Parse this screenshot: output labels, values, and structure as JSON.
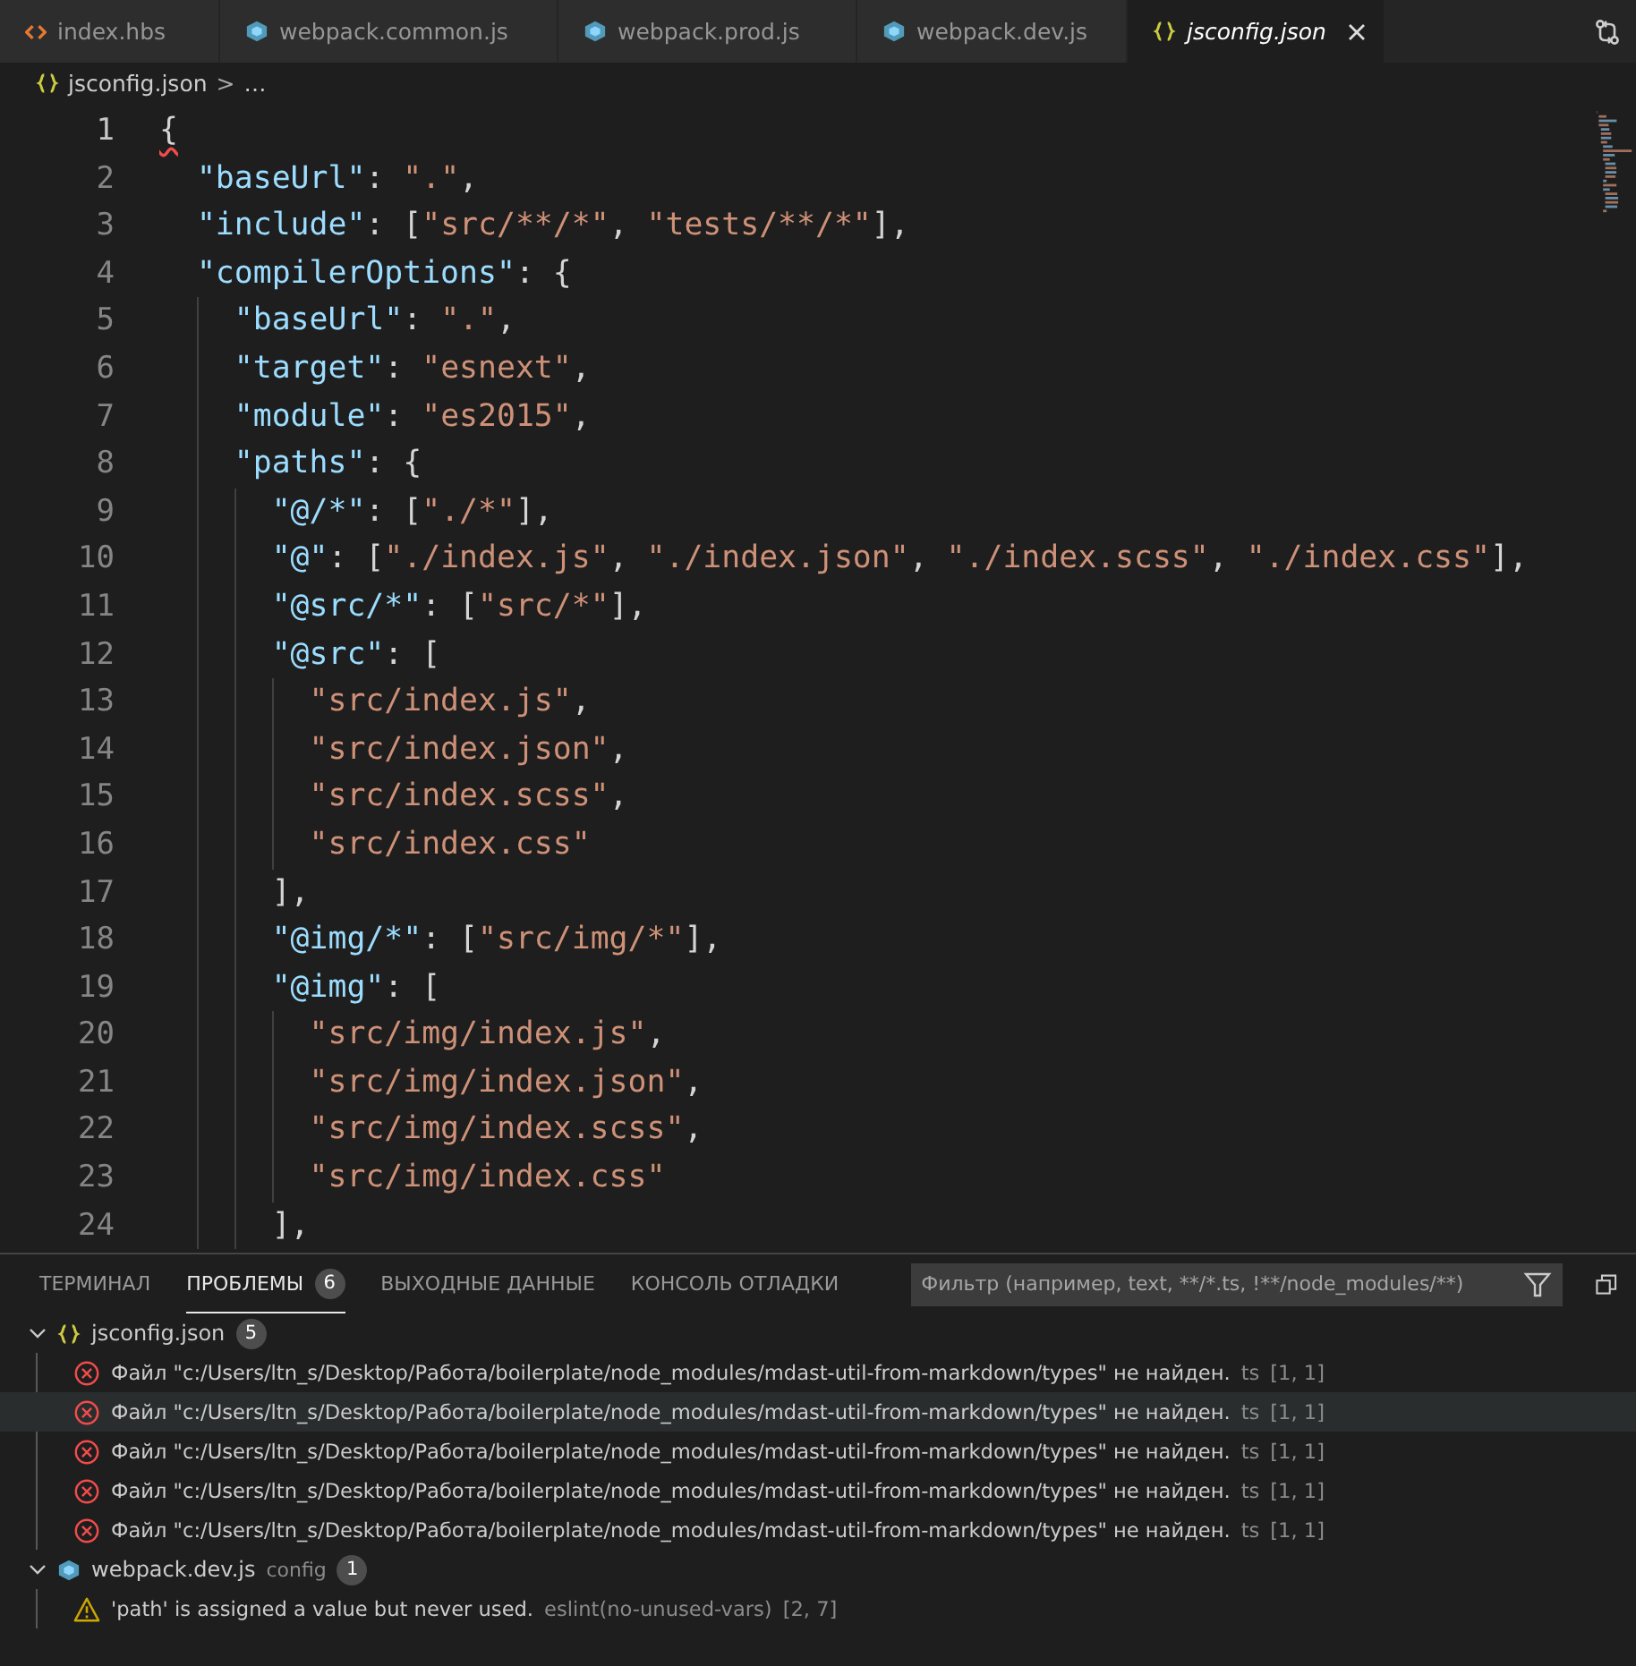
{
  "tabs": [
    {
      "label": "index.hbs",
      "kind": "html",
      "selected": false,
      "italic": false
    },
    {
      "label": "webpack.common.js",
      "kind": "webpack",
      "selected": false,
      "italic": false
    },
    {
      "label": "webpack.prod.js",
      "kind": "webpack",
      "selected": false,
      "italic": false
    },
    {
      "label": "webpack.dev.js",
      "kind": "webpack",
      "selected": false,
      "italic": false
    },
    {
      "label": "jsconfig.json",
      "kind": "json",
      "selected": true,
      "italic": true
    }
  ],
  "breadcrumb": {
    "kind": "json",
    "file": "jsconfig.json",
    "separator": ">",
    "rest": "…"
  },
  "editor": {
    "lines": [
      {
        "number": "1",
        "current": true,
        "squiggle": true,
        "tokens": [
          {
            "kind": "punct",
            "text": "{"
          }
        ]
      },
      {
        "number": "2",
        "current": false,
        "squiggle": false,
        "tokens": [
          {
            "kind": "key",
            "text": "  \"baseUrl\""
          },
          {
            "kind": "punct",
            "text": ": "
          },
          {
            "kind": "string",
            "text": "\".\""
          },
          {
            "kind": "punct",
            "text": ","
          }
        ]
      },
      {
        "number": "3",
        "current": false,
        "squiggle": false,
        "tokens": [
          {
            "kind": "key",
            "text": "  \"include\""
          },
          {
            "kind": "punct",
            "text": ": ["
          },
          {
            "kind": "string",
            "text": "\"src/**/*\""
          },
          {
            "kind": "punct",
            "text": ", "
          },
          {
            "kind": "string",
            "text": "\"tests/**/*\""
          },
          {
            "kind": "punct",
            "text": "],"
          }
        ]
      },
      {
        "number": "4",
        "current": false,
        "squiggle": false,
        "tokens": [
          {
            "kind": "key",
            "text": "  \"compilerOptions\""
          },
          {
            "kind": "punct",
            "text": ": {"
          }
        ]
      },
      {
        "number": "5",
        "current": false,
        "squiggle": false,
        "tokens": [
          {
            "kind": "key",
            "text": "    \"baseUrl\""
          },
          {
            "kind": "punct",
            "text": ": "
          },
          {
            "kind": "string",
            "text": "\".\""
          },
          {
            "kind": "punct",
            "text": ","
          }
        ]
      },
      {
        "number": "6",
        "current": false,
        "squiggle": false,
        "tokens": [
          {
            "kind": "key",
            "text": "    \"target\""
          },
          {
            "kind": "punct",
            "text": ": "
          },
          {
            "kind": "string",
            "text": "\"esnext\""
          },
          {
            "kind": "punct",
            "text": ","
          }
        ]
      },
      {
        "number": "7",
        "current": false,
        "squiggle": false,
        "tokens": [
          {
            "kind": "key",
            "text": "    \"module\""
          },
          {
            "kind": "punct",
            "text": ": "
          },
          {
            "kind": "string",
            "text": "\"es2015\""
          },
          {
            "kind": "punct",
            "text": ","
          }
        ]
      },
      {
        "number": "8",
        "current": false,
        "squiggle": false,
        "tokens": [
          {
            "kind": "key",
            "text": "    \"paths\""
          },
          {
            "kind": "punct",
            "text": ": {"
          }
        ]
      },
      {
        "number": "9",
        "current": false,
        "squiggle": false,
        "tokens": [
          {
            "kind": "key",
            "text": "      \"@/*\""
          },
          {
            "kind": "punct",
            "text": ": ["
          },
          {
            "kind": "string",
            "text": "\"./*\""
          },
          {
            "kind": "punct",
            "text": "],"
          }
        ]
      },
      {
        "number": "10",
        "current": false,
        "squiggle": false,
        "tokens": [
          {
            "kind": "key",
            "text": "      \"@\""
          },
          {
            "kind": "punct",
            "text": ": ["
          },
          {
            "kind": "string",
            "text": "\"./index.js\""
          },
          {
            "kind": "punct",
            "text": ", "
          },
          {
            "kind": "string",
            "text": "\"./index.json\""
          },
          {
            "kind": "punct",
            "text": ", "
          },
          {
            "kind": "string",
            "text": "\"./index.scss\""
          },
          {
            "kind": "punct",
            "text": ", "
          },
          {
            "kind": "string",
            "text": "\"./index.css\""
          },
          {
            "kind": "punct",
            "text": "],"
          }
        ]
      },
      {
        "number": "11",
        "current": false,
        "squiggle": false,
        "tokens": [
          {
            "kind": "key",
            "text": "      \"@src/*\""
          },
          {
            "kind": "punct",
            "text": ": ["
          },
          {
            "kind": "string",
            "text": "\"src/*\""
          },
          {
            "kind": "punct",
            "text": "],"
          }
        ]
      },
      {
        "number": "12",
        "current": false,
        "squiggle": false,
        "tokens": [
          {
            "kind": "key",
            "text": "      \"@src\""
          },
          {
            "kind": "punct",
            "text": ": ["
          }
        ]
      },
      {
        "number": "13",
        "current": false,
        "squiggle": false,
        "tokens": [
          {
            "kind": "string",
            "text": "        \"src/index.js\""
          },
          {
            "kind": "punct",
            "text": ","
          }
        ]
      },
      {
        "number": "14",
        "current": false,
        "squiggle": false,
        "tokens": [
          {
            "kind": "string",
            "text": "        \"src/index.json\""
          },
          {
            "kind": "punct",
            "text": ","
          }
        ]
      },
      {
        "number": "15",
        "current": false,
        "squiggle": false,
        "tokens": [
          {
            "kind": "string",
            "text": "        \"src/index.scss\""
          },
          {
            "kind": "punct",
            "text": ","
          }
        ]
      },
      {
        "number": "16",
        "current": false,
        "squiggle": false,
        "tokens": [
          {
            "kind": "string",
            "text": "        \"src/index.css\""
          }
        ]
      },
      {
        "number": "17",
        "current": false,
        "squiggle": false,
        "tokens": [
          {
            "kind": "punct",
            "text": "      ],"
          }
        ]
      },
      {
        "number": "18",
        "current": false,
        "squiggle": false,
        "tokens": [
          {
            "kind": "key",
            "text": "      \"@img/*\""
          },
          {
            "kind": "punct",
            "text": ": ["
          },
          {
            "kind": "string",
            "text": "\"src/img/*\""
          },
          {
            "kind": "punct",
            "text": "],"
          }
        ]
      },
      {
        "number": "19",
        "current": false,
        "squiggle": false,
        "tokens": [
          {
            "kind": "key",
            "text": "      \"@img\""
          },
          {
            "kind": "punct",
            "text": ": ["
          }
        ]
      },
      {
        "number": "20",
        "current": false,
        "squiggle": false,
        "tokens": [
          {
            "kind": "string",
            "text": "        \"src/img/index.js\""
          },
          {
            "kind": "punct",
            "text": ","
          }
        ]
      },
      {
        "number": "21",
        "current": false,
        "squiggle": false,
        "tokens": [
          {
            "kind": "string",
            "text": "        \"src/img/index.json\""
          },
          {
            "kind": "punct",
            "text": ","
          }
        ]
      },
      {
        "number": "22",
        "current": false,
        "squiggle": false,
        "tokens": [
          {
            "kind": "string",
            "text": "        \"src/img/index.scss\""
          },
          {
            "kind": "punct",
            "text": ","
          }
        ]
      },
      {
        "number": "23",
        "current": false,
        "squiggle": false,
        "tokens": [
          {
            "kind": "string",
            "text": "        \"src/img/index.css\""
          }
        ]
      },
      {
        "number": "24",
        "current": false,
        "squiggle": false,
        "tokens": [
          {
            "kind": "punct",
            "text": "      ],"
          }
        ]
      }
    ]
  },
  "panel": {
    "tabs": [
      {
        "label": "ТЕРМИНАЛ",
        "selected": false
      },
      {
        "label": "ПРОБЛЕМЫ",
        "selected": true,
        "count": "6"
      },
      {
        "label": "ВЫХОДНЫЕ ДАННЫЕ",
        "selected": false
      },
      {
        "label": "КОНСОЛЬ ОТЛАДКИ",
        "selected": false
      }
    ],
    "filter": {
      "placeholder": "Фильтр (например, text, **/*.ts, !**/node_modules/**)"
    },
    "groups": [
      {
        "kind": "json",
        "file": "jsconfig.json",
        "count": "5",
        "expanded": true,
        "problems": [
          {
            "kind": "error",
            "selected": false,
            "message": "Файл \"c:/Users/ltn_s/Desktop/Работа/boilerplate/node_modules/mdast-util-from-markdown/types\" не найден.",
            "source": "ts",
            "location": "[1, 1]"
          },
          {
            "kind": "error",
            "selected": true,
            "message": "Файл \"c:/Users/ltn_s/Desktop/Работа/boilerplate/node_modules/mdast-util-from-markdown/types\" не найден.",
            "source": "ts",
            "location": "[1, 1]"
          },
          {
            "kind": "error",
            "selected": false,
            "message": "Файл \"c:/Users/ltn_s/Desktop/Работа/boilerplate/node_modules/mdast-util-from-markdown/types\" не найден.",
            "source": "ts",
            "location": "[1, 1]"
          },
          {
            "kind": "error",
            "selected": false,
            "message": "Файл \"c:/Users/ltn_s/Desktop/Работа/boilerplate/node_modules/mdast-util-from-markdown/types\" не найден.",
            "source": "ts",
            "location": "[1, 1]"
          },
          {
            "kind": "error",
            "selected": false,
            "message": "Файл \"c:/Users/ltn_s/Desktop/Работа/boilerplate/node_modules/mdast-util-from-markdown/types\" не найден.",
            "source": "ts",
            "location": "[1, 1]"
          }
        ]
      },
      {
        "kind": "webpack",
        "file": "webpack.dev.js",
        "description": "config",
        "count": "1",
        "expanded": true,
        "problems": [
          {
            "kind": "warning",
            "selected": false,
            "message": "'path' is assigned a value but never used.",
            "source": "eslint(no-unused-vars)",
            "location": "[2, 7]"
          }
        ]
      }
    ]
  }
}
